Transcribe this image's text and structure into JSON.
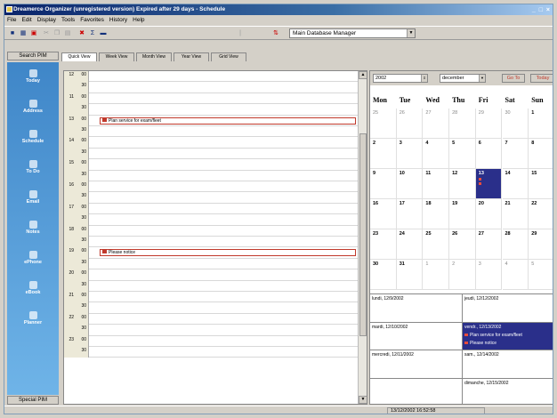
{
  "window": {
    "title": "Dreamerce Organizer (unregistered version) Expired after 29 days - Schedule"
  },
  "menu": [
    "File",
    "Edit",
    "Display",
    "Tools",
    "Favorites",
    "History",
    "Help"
  ],
  "toolbar": {
    "db_selector": "Main Database Manager"
  },
  "nav": {
    "header": "Search PIM",
    "footer": "Special PIM",
    "items": [
      {
        "label": "Today",
        "icon": "today-icon"
      },
      {
        "label": "Address",
        "icon": "address-book-icon"
      },
      {
        "label": "Schedule",
        "icon": "schedule-icon"
      },
      {
        "label": "To Do",
        "icon": "todo-icon"
      },
      {
        "label": "Email",
        "icon": "email-icon"
      },
      {
        "label": "Notes",
        "icon": "notes-icon"
      },
      {
        "label": "ePhone",
        "icon": "phone-icon"
      },
      {
        "label": "eBook",
        "icon": "ebook-icon"
      },
      {
        "label": "Planner",
        "icon": "planner-icon"
      }
    ]
  },
  "tabs": [
    "Quick View",
    "Week View",
    "Month View",
    "Year View",
    "Grid View"
  ],
  "day_view": {
    "rows": [
      {
        "h": "12",
        "m": "00"
      },
      {
        "h": "",
        "m": "30"
      },
      {
        "h": "11",
        "m": "00"
      },
      {
        "h": "",
        "m": "30"
      },
      {
        "h": "13",
        "m": "00"
      },
      {
        "h": "",
        "m": "30"
      },
      {
        "h": "14",
        "m": "00"
      },
      {
        "h": "",
        "m": "30"
      },
      {
        "h": "15",
        "m": "00"
      },
      {
        "h": "",
        "m": "30"
      },
      {
        "h": "16",
        "m": "00"
      },
      {
        "h": "",
        "m": "30"
      },
      {
        "h": "17",
        "m": "00"
      },
      {
        "h": "",
        "m": "30"
      },
      {
        "h": "18",
        "m": "00"
      },
      {
        "h": "",
        "m": "30"
      },
      {
        "h": "19",
        "m": "00"
      },
      {
        "h": "",
        "m": "30"
      },
      {
        "h": "20",
        "m": "00"
      },
      {
        "h": "",
        "m": "30"
      },
      {
        "h": "21",
        "m": "00"
      },
      {
        "h": "",
        "m": "30"
      },
      {
        "h": "22",
        "m": "00"
      },
      {
        "h": "",
        "m": "30"
      },
      {
        "h": "23",
        "m": "00"
      },
      {
        "h": "",
        "m": "30"
      }
    ],
    "appointments": [
      {
        "row": 4,
        "text": "Plan service for exam/fleet"
      },
      {
        "row": 16,
        "text": "Please notice"
      }
    ]
  },
  "calendar": {
    "year": "2002",
    "month": "december",
    "go_label": "Go To",
    "today_label": "Today",
    "days_of_week": [
      "Mon",
      "Tue",
      "Wed",
      "Thu",
      "Fri",
      "Sat",
      "Sun"
    ],
    "weeks": [
      [
        {
          "d": "25",
          "c": false
        },
        {
          "d": "26",
          "c": false
        },
        {
          "d": "27",
          "c": false
        },
        {
          "d": "28",
          "c": false
        },
        {
          "d": "29",
          "c": false
        },
        {
          "d": "30",
          "c": false
        },
        {
          "d": "1",
          "c": true
        }
      ],
      [
        {
          "d": "2",
          "c": true
        },
        {
          "d": "3",
          "c": true
        },
        {
          "d": "4",
          "c": true
        },
        {
          "d": "5",
          "c": true
        },
        {
          "d": "6",
          "c": true
        },
        {
          "d": "7",
          "c": true
        },
        {
          "d": "8",
          "c": true
        }
      ],
      [
        {
          "d": "9",
          "c": true
        },
        {
          "d": "10",
          "c": true
        },
        {
          "d": "11",
          "c": true
        },
        {
          "d": "12",
          "c": true
        },
        {
          "d": "13",
          "c": true,
          "sel": true
        },
        {
          "d": "14",
          "c": true
        },
        {
          "d": "15",
          "c": true
        }
      ],
      [
        {
          "d": "16",
          "c": true
        },
        {
          "d": "17",
          "c": true
        },
        {
          "d": "18",
          "c": true
        },
        {
          "d": "19",
          "c": true
        },
        {
          "d": "20",
          "c": true
        },
        {
          "d": "21",
          "c": true
        },
        {
          "d": "22",
          "c": true
        }
      ],
      [
        {
          "d": "23",
          "c": true
        },
        {
          "d": "24",
          "c": true
        },
        {
          "d": "25",
          "c": true
        },
        {
          "d": "26",
          "c": true
        },
        {
          "d": "27",
          "c": true
        },
        {
          "d": "28",
          "c": true
        },
        {
          "d": "29",
          "c": true
        }
      ],
      [
        {
          "d": "30",
          "c": true
        },
        {
          "d": "31",
          "c": true
        },
        {
          "d": "1",
          "c": false
        },
        {
          "d": "2",
          "c": false
        },
        {
          "d": "3",
          "c": false
        },
        {
          "d": "4",
          "c": false
        },
        {
          "d": "5",
          "c": false
        }
      ]
    ]
  },
  "events": [
    {
      "title": "lundi, 12/9/2002",
      "items": [],
      "hl": false
    },
    {
      "title": "jeudi, 12/12/2002",
      "items": [],
      "hl": false
    },
    {
      "title": "mardi, 12/10/2002",
      "items": [],
      "hl": false
    },
    {
      "title": "vendr., 12/13/2002",
      "items": [
        "Plan service for exam/fleet",
        "Please notice"
      ],
      "hl": true
    },
    {
      "title": "mercredi, 12/11/2002",
      "items": [],
      "hl": false
    },
    {
      "title": "sam., 12/14/2002",
      "items": [],
      "hl": false
    },
    {
      "title": "",
      "items": [],
      "hl": false
    },
    {
      "title": "dimanche, 12/15/2002",
      "items": [],
      "hl": false
    }
  ],
  "status": {
    "datetime": "13/12/2002  16:52:58"
  }
}
